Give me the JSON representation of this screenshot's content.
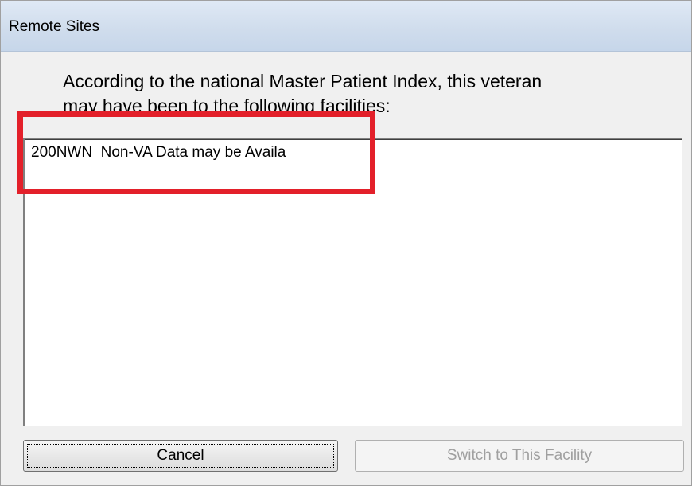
{
  "window": {
    "title": "Remote Sites"
  },
  "message": {
    "line1": "According to the national Master Patient Index, this veteran",
    "line2": "may have been to the following facilities:"
  },
  "facility_list": {
    "items": [
      "200NWN  Non-VA Data may be Availa"
    ]
  },
  "buttons": {
    "cancel_label": "Cancel",
    "switch_label": "Switch to This Facility",
    "switch_enabled": false
  },
  "colors": {
    "annotation_red": "#e3202a",
    "titlebar": "#cfdcec",
    "dialog_bg": "#f0f0f0"
  }
}
